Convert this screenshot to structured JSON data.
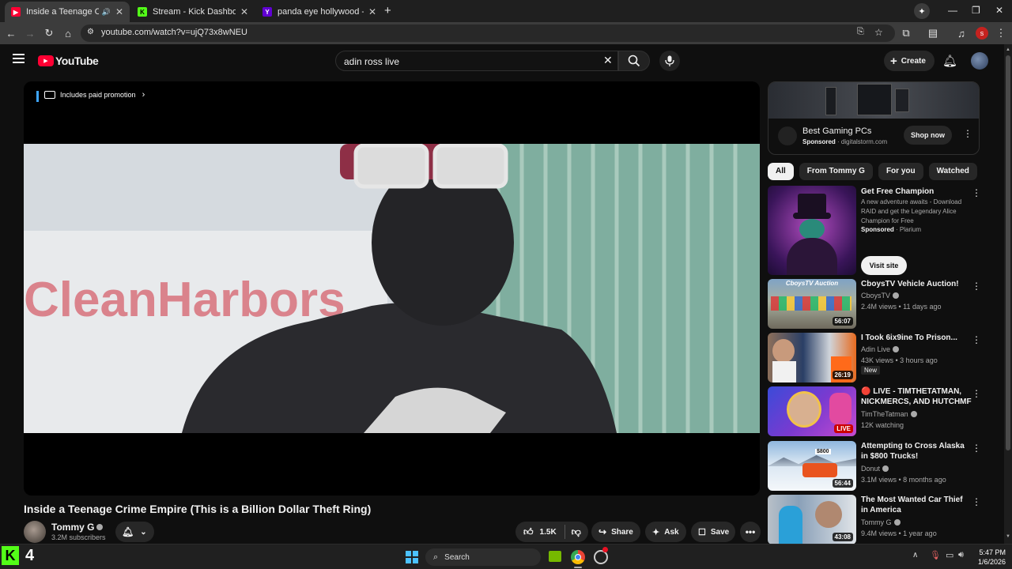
{
  "browser": {
    "tabs": [
      {
        "title": "Inside a Teenage Crime Em",
        "active": true
      },
      {
        "title": "Stream - Kick Dashboard",
        "active": false
      },
      {
        "title": "panda eye hollywood - - Image",
        "active": false
      }
    ],
    "url": "youtube.com/watch?v=ujQ73x8wNEU",
    "profile_initial": "s"
  },
  "youtube": {
    "logo_text": "YouTube",
    "search_query": "adin ross live",
    "create_label": "Create"
  },
  "player": {
    "paid_promotion": "Includes paid promotion"
  },
  "video": {
    "title": "Inside a Teenage Crime Empire (This is a Billion Dollar Theft Ring)",
    "channel": "Tommy G",
    "subscribers": "3.2M subscribers",
    "likes": "1.5K",
    "share": "Share",
    "ask": "Ask",
    "save": "Save"
  },
  "ad": {
    "title": "Best Gaming PCs",
    "sponsored": "Sponsored",
    "domain": "digitalstorm.com",
    "cta": "Shop now"
  },
  "chips": [
    "All",
    "From Tommy G",
    "For you",
    "Watched"
  ],
  "sponsored_item": {
    "title": "Get Free Champion",
    "desc": "A new adventure awaits - Download RAID and get the Legendary Alice Champion for Free",
    "sponsored": "Sponsored",
    "advertiser": "Plarium",
    "cta": "Visit site"
  },
  "suggestions": [
    {
      "title": "CboysTV Vehicle Auction!",
      "channel": "CboysTV",
      "meta": "2.4M views • 11 days ago",
      "duration": "56:07",
      "thumb_text": "CboysTV Auction"
    },
    {
      "title": "I Took 6ix9ine To Prison...",
      "channel": "Adin Live",
      "meta": "43K views • 3 hours ago",
      "duration": "26:19",
      "badge": "New"
    },
    {
      "title": "🔴 LIVE - TIMTHETATMAN, NICKMERCS, AND HUTCHMF ...",
      "channel": "TimTheTatman",
      "meta": "12K watching",
      "duration": "LIVE"
    },
    {
      "title": "Attempting to Cross Alaska in $800 Trucks!",
      "channel": "Donut",
      "meta": "3.1M views • 8 months ago",
      "duration": "56:44",
      "thumb_text": "$800"
    },
    {
      "title": "The Most Wanted Car Thief in America",
      "channel": "Tommy G",
      "meta": "9.4M views • 1 year ago",
      "duration": "43:08"
    }
  ],
  "taskbar": {
    "kick_count": "4",
    "search_label": "Search",
    "time": "5:47 PM",
    "date": "1/6/2026"
  }
}
